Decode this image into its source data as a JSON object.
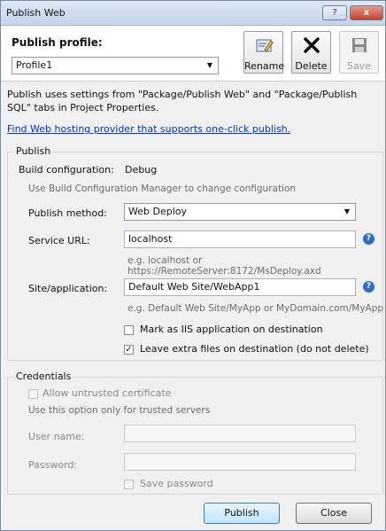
{
  "window": {
    "title": "Publish Web",
    "help_btn": "?",
    "close_btn": "x"
  },
  "profile": {
    "label": "Publish profile:",
    "selected": "Profile1",
    "buttons": {
      "rename": "Rename",
      "delete": "Delete",
      "save": "Save"
    }
  },
  "info_text": "Publish uses settings from \"Package/Publish Web\" and \"Package/Publish SQL\" tabs in Project Properties.",
  "hosting_link": "Find Web hosting provider that supports one-click publish.",
  "publish": {
    "group_label": "Publish",
    "build_config_label": "Build configuration:",
    "build_config_value": "Debug",
    "build_hint": "Use Build Configuration Manager to change configuration",
    "method_label": "Publish method:",
    "method_value": "Web Deploy",
    "service_url_label": "Service URL:",
    "service_url_value": "localhost",
    "service_url_hint": "e.g. localhost or https://RemoteServer:8172/MsDeploy.axd",
    "site_label": "Site/application:",
    "site_value": "Default Web Site/WebApp1",
    "site_hint": "e.g. Default Web Site/MyApp or MyDomain.com/MyApp",
    "mark_iis": {
      "label": "Mark as IIS application on destination",
      "checked": false
    },
    "leave_extra": {
      "label": "Leave extra files on destination (do not delete)",
      "checked": true
    }
  },
  "credentials": {
    "group_label": "Credentials",
    "allow_untrusted": {
      "label": "Allow untrusted certificate",
      "checked": false
    },
    "trusted_hint": "Use this option only for trusted servers",
    "username_label": "User name:",
    "username_value": "",
    "password_label": "Password:",
    "password_value": "",
    "save_password": {
      "label": "Save password",
      "checked": false
    }
  },
  "footer": {
    "publish_btn": "Publish",
    "close_btn": "Close"
  },
  "icons": {
    "help": "question-mark-icon",
    "rename": "rename-icon",
    "delete": "delete-x-icon",
    "save": "floppy-disk-icon"
  }
}
